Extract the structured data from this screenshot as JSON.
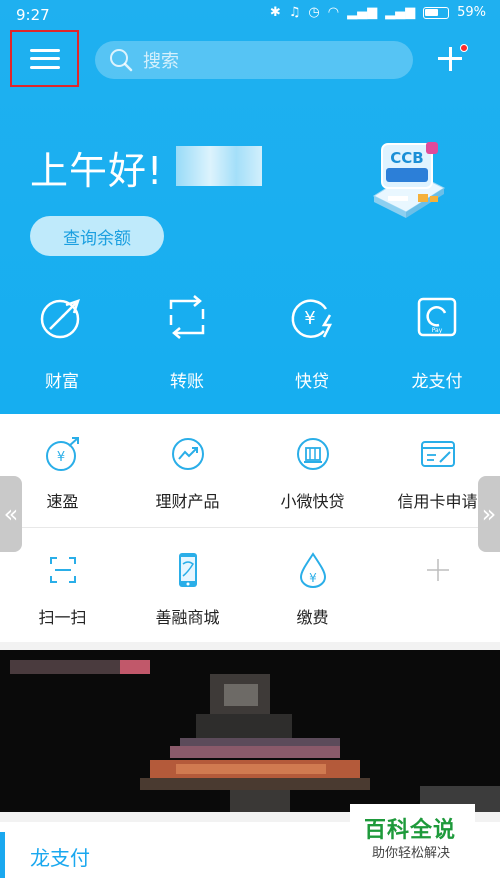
{
  "status_bar": {
    "time": "9:27",
    "battery": "59%"
  },
  "header": {
    "search_placeholder": "搜索"
  },
  "greeting": {
    "text": "上午好!"
  },
  "balance_button": {
    "label": "查询余额"
  },
  "quick_actions": [
    {
      "label": "财富",
      "icon": "wealth-icon"
    },
    {
      "label": "转账",
      "icon": "transfer-icon"
    },
    {
      "label": "快贷",
      "icon": "quick-loan-icon"
    },
    {
      "label": "龙支付",
      "icon": "long-pay-icon"
    }
  ],
  "services": {
    "row1": [
      {
        "label": "速盈",
        "icon": "suying-icon"
      },
      {
        "label": "理财产品",
        "icon": "finance-products-icon"
      },
      {
        "label": "小微快贷",
        "icon": "micro-loan-icon"
      },
      {
        "label": "信用卡申请",
        "icon": "credit-card-apply-icon"
      }
    ],
    "row2": [
      {
        "label": "扫一扫",
        "icon": "scan-icon"
      },
      {
        "label": "善融商城",
        "icon": "mall-icon"
      },
      {
        "label": "缴费",
        "icon": "payment-icon"
      }
    ]
  },
  "side_arrows": {
    "left": "«",
    "right": "»"
  },
  "bottom_section": {
    "title": "龙支付"
  },
  "watermark": {
    "title": "百科全说",
    "subtitle": "助你轻松解决"
  },
  "colors": {
    "brand_blue": "#1fb0f0",
    "menu_highlight": "#e0262a",
    "watermark_green": "#1e9a3b"
  }
}
